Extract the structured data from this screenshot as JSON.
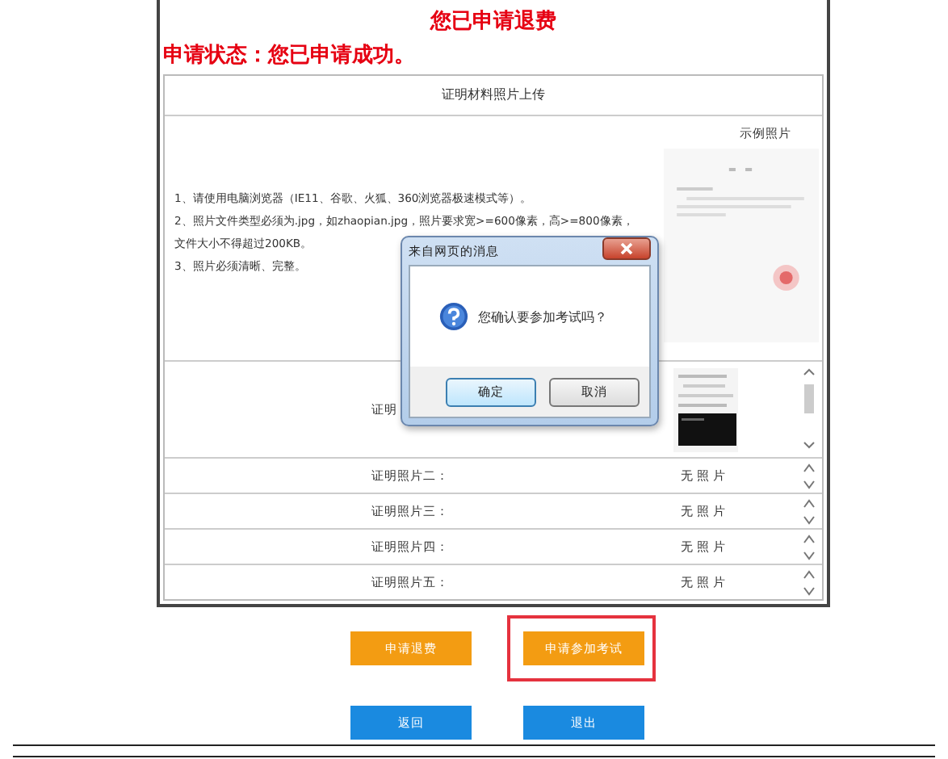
{
  "header": {
    "refund_notice": "您已申请退费",
    "status": "申请状态：您已申请成功。"
  },
  "upload_table": {
    "title": "证明材料照片上传",
    "sample_label": "示例照片",
    "instructions": [
      "1、请使用电脑浏览器（IE11、谷歌、火狐、360浏览器极速模式等）。",
      "2、照片文件类型必须为.jpg，如zhaopian.jpg，照片要求宽>=600像素，高>=800像素，",
      "文件大小不得超过200KB。",
      "3、照片必须清晰、完整。"
    ],
    "photos": [
      {
        "label": "证明",
        "kind": "picture"
      },
      {
        "label": "证明照片二：",
        "kind": "text",
        "value": "无照片"
      },
      {
        "label": "证明照片三：",
        "kind": "text",
        "value": "无照片"
      },
      {
        "label": "证明照片四：",
        "kind": "text",
        "value": "无照片"
      },
      {
        "label": "证明照片五：",
        "kind": "text",
        "value": "无照片"
      }
    ]
  },
  "buttons": [
    {
      "label": "申请退费",
      "kind": "action",
      "highlighted": false
    },
    {
      "label": "申请参加考试",
      "kind": "action",
      "highlighted": true
    },
    {
      "label": "返回",
      "kind": "nav",
      "highlighted": false
    },
    {
      "label": "退出",
      "kind": "nav",
      "highlighted": false
    }
  ],
  "dialog": {
    "title": "来自网页的消息",
    "message": "您确认要参加考试吗？",
    "buttons": [
      {
        "label": "确定",
        "focused": true
      },
      {
        "label": "取消",
        "focused": false
      }
    ]
  }
}
